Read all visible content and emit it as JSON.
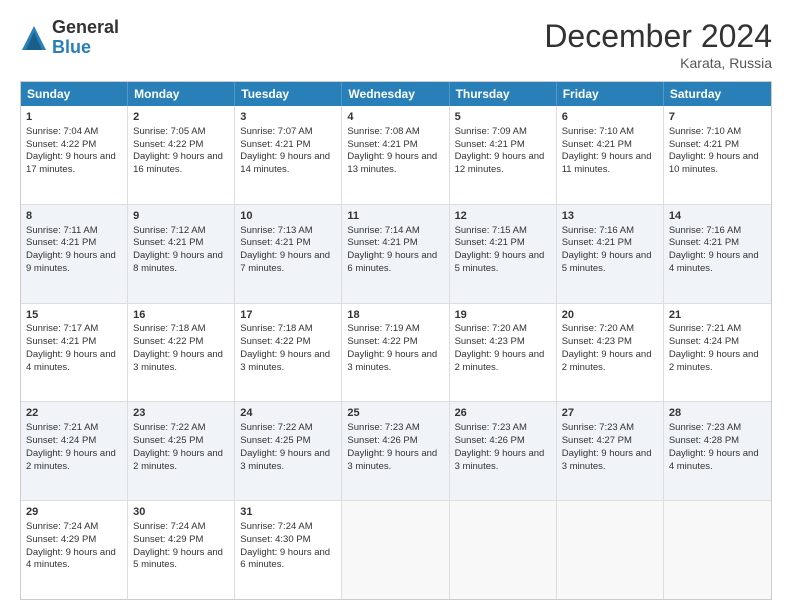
{
  "logo": {
    "general": "General",
    "blue": "Blue"
  },
  "title": "December 2024",
  "location": "Karata, Russia",
  "days_of_week": [
    "Sunday",
    "Monday",
    "Tuesday",
    "Wednesday",
    "Thursday",
    "Friday",
    "Saturday"
  ],
  "rows": [
    {
      "alt": false,
      "cells": [
        {
          "day": 1,
          "info": "Sunrise: 7:04 AM\nSunset: 4:22 PM\nDaylight: 9 hours and 17 minutes."
        },
        {
          "day": 2,
          "info": "Sunrise: 7:05 AM\nSunset: 4:22 PM\nDaylight: 9 hours and 16 minutes."
        },
        {
          "day": 3,
          "info": "Sunrise: 7:07 AM\nSunset: 4:21 PM\nDaylight: 9 hours and 14 minutes."
        },
        {
          "day": 4,
          "info": "Sunrise: 7:08 AM\nSunset: 4:21 PM\nDaylight: 9 hours and 13 minutes."
        },
        {
          "day": 5,
          "info": "Sunrise: 7:09 AM\nSunset: 4:21 PM\nDaylight: 9 hours and 12 minutes."
        },
        {
          "day": 6,
          "info": "Sunrise: 7:10 AM\nSunset: 4:21 PM\nDaylight: 9 hours and 11 minutes."
        },
        {
          "day": 7,
          "info": "Sunrise: 7:10 AM\nSunset: 4:21 PM\nDaylight: 9 hours and 10 minutes."
        }
      ]
    },
    {
      "alt": true,
      "cells": [
        {
          "day": 8,
          "info": "Sunrise: 7:11 AM\nSunset: 4:21 PM\nDaylight: 9 hours and 9 minutes."
        },
        {
          "day": 9,
          "info": "Sunrise: 7:12 AM\nSunset: 4:21 PM\nDaylight: 9 hours and 8 minutes."
        },
        {
          "day": 10,
          "info": "Sunrise: 7:13 AM\nSunset: 4:21 PM\nDaylight: 9 hours and 7 minutes."
        },
        {
          "day": 11,
          "info": "Sunrise: 7:14 AM\nSunset: 4:21 PM\nDaylight: 9 hours and 6 minutes."
        },
        {
          "day": 12,
          "info": "Sunrise: 7:15 AM\nSunset: 4:21 PM\nDaylight: 9 hours and 5 minutes."
        },
        {
          "day": 13,
          "info": "Sunrise: 7:16 AM\nSunset: 4:21 PM\nDaylight: 9 hours and 5 minutes."
        },
        {
          "day": 14,
          "info": "Sunrise: 7:16 AM\nSunset: 4:21 PM\nDaylight: 9 hours and 4 minutes."
        }
      ]
    },
    {
      "alt": false,
      "cells": [
        {
          "day": 15,
          "info": "Sunrise: 7:17 AM\nSunset: 4:21 PM\nDaylight: 9 hours and 4 minutes."
        },
        {
          "day": 16,
          "info": "Sunrise: 7:18 AM\nSunset: 4:22 PM\nDaylight: 9 hours and 3 minutes."
        },
        {
          "day": 17,
          "info": "Sunrise: 7:18 AM\nSunset: 4:22 PM\nDaylight: 9 hours and 3 minutes."
        },
        {
          "day": 18,
          "info": "Sunrise: 7:19 AM\nSunset: 4:22 PM\nDaylight: 9 hours and 3 minutes."
        },
        {
          "day": 19,
          "info": "Sunrise: 7:20 AM\nSunset: 4:23 PM\nDaylight: 9 hours and 2 minutes."
        },
        {
          "day": 20,
          "info": "Sunrise: 7:20 AM\nSunset: 4:23 PM\nDaylight: 9 hours and 2 minutes."
        },
        {
          "day": 21,
          "info": "Sunrise: 7:21 AM\nSunset: 4:24 PM\nDaylight: 9 hours and 2 minutes."
        }
      ]
    },
    {
      "alt": true,
      "cells": [
        {
          "day": 22,
          "info": "Sunrise: 7:21 AM\nSunset: 4:24 PM\nDaylight: 9 hours and 2 minutes."
        },
        {
          "day": 23,
          "info": "Sunrise: 7:22 AM\nSunset: 4:25 PM\nDaylight: 9 hours and 2 minutes."
        },
        {
          "day": 24,
          "info": "Sunrise: 7:22 AM\nSunset: 4:25 PM\nDaylight: 9 hours and 3 minutes."
        },
        {
          "day": 25,
          "info": "Sunrise: 7:23 AM\nSunset: 4:26 PM\nDaylight: 9 hours and 3 minutes."
        },
        {
          "day": 26,
          "info": "Sunrise: 7:23 AM\nSunset: 4:26 PM\nDaylight: 9 hours and 3 minutes."
        },
        {
          "day": 27,
          "info": "Sunrise: 7:23 AM\nSunset: 4:27 PM\nDaylight: 9 hours and 3 minutes."
        },
        {
          "day": 28,
          "info": "Sunrise: 7:23 AM\nSunset: 4:28 PM\nDaylight: 9 hours and 4 minutes."
        }
      ]
    },
    {
      "alt": false,
      "cells": [
        {
          "day": 29,
          "info": "Sunrise: 7:24 AM\nSunset: 4:29 PM\nDaylight: 9 hours and 4 minutes."
        },
        {
          "day": 30,
          "info": "Sunrise: 7:24 AM\nSunset: 4:29 PM\nDaylight: 9 hours and 5 minutes."
        },
        {
          "day": 31,
          "info": "Sunrise: 7:24 AM\nSunset: 4:30 PM\nDaylight: 9 hours and 6 minutes."
        },
        {
          "day": null
        },
        {
          "day": null
        },
        {
          "day": null
        },
        {
          "day": null
        }
      ]
    }
  ]
}
